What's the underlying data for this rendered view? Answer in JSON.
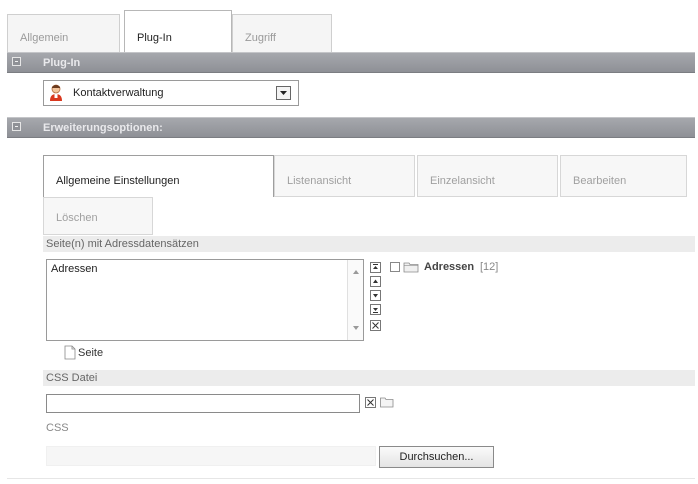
{
  "top_tabs": [
    {
      "label": "Allgemein",
      "active": false
    },
    {
      "label": "Plug-In",
      "active": true
    },
    {
      "label": "Zugriff",
      "active": false
    }
  ],
  "plugin_section": {
    "title": "Plug-In",
    "plugin_select_value": "Kontaktverwaltung"
  },
  "ext_section": {
    "title": "Erweiterungsoptionen:"
  },
  "sub_tabs": [
    {
      "label": "Allgemeine Einstellungen",
      "active": true
    },
    {
      "label": "Listenansicht",
      "active": false
    },
    {
      "label": "Einzelansicht",
      "active": false
    },
    {
      "label": "Bearbeiten",
      "active": false
    },
    {
      "label": "Löschen",
      "active": false
    }
  ],
  "pages_field": {
    "label": "Seite(n) mit Adressdatensätzen",
    "selected_items": [
      "Adressen"
    ],
    "browser_item": {
      "name": "Adressen",
      "count": "[12]"
    },
    "add_page_label": "Seite"
  },
  "css_file_field": {
    "label": "CSS Datei",
    "value": ""
  },
  "css_field": {
    "label": "CSS",
    "browse_label": "Durchsuchen..."
  },
  "colors": {
    "section_bar": "#9a9ca1",
    "tab_border": "#b7b7b7"
  }
}
